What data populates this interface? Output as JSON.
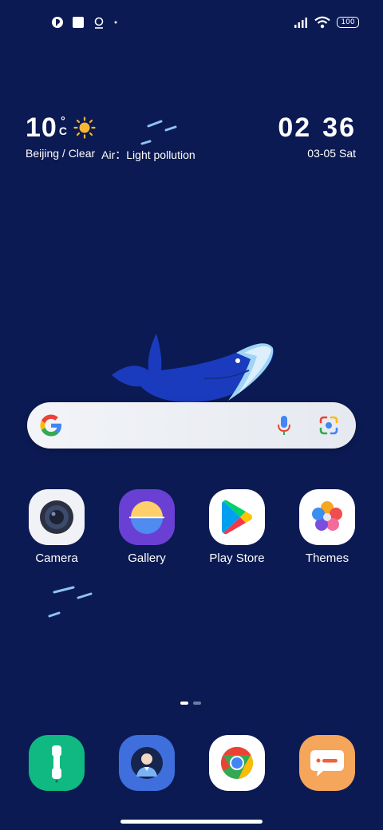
{
  "status_bar": {
    "left_icons": [
      "app-notification-icon",
      "square-notification-icon",
      "location-pin-icon",
      "more-dot-icon"
    ],
    "right_icons": [
      "cellular-signal-icon",
      "wifi-icon"
    ],
    "battery_level": "100"
  },
  "weather": {
    "temperature": "10",
    "degree_symbol": "°",
    "unit": "C",
    "icon": "sun-icon",
    "location_condition": "Beijing / Clear",
    "air_quality": "Air：Light pollution"
  },
  "clock": {
    "hours": "02",
    "minutes": "36",
    "date": "03-05 Sat"
  },
  "search_bar": {
    "icons": [
      "google-logo-icon",
      "microphone-icon",
      "google-lens-icon"
    ]
  },
  "apps": [
    {
      "label": "Camera",
      "icon": "camera-icon"
    },
    {
      "label": "Gallery",
      "icon": "gallery-icon"
    },
    {
      "label": "Play Store",
      "icon": "play-store-icon"
    },
    {
      "label": "Themes",
      "icon": "themes-icon"
    }
  ],
  "dock": [
    {
      "icon": "phone-manager-icon"
    },
    {
      "icon": "contacts-icon"
    },
    {
      "icon": "chrome-icon"
    },
    {
      "icon": "messages-icon"
    }
  ],
  "page_indicator": {
    "count": 2,
    "active": 1
  },
  "colors": {
    "background": "#0b1a52",
    "text": "#ffffff",
    "gallery_bg": "#6a3fd4",
    "dock_green": "#10b981",
    "dock_blue": "#3f6fdc",
    "dock_orange": "#f5a65b"
  }
}
